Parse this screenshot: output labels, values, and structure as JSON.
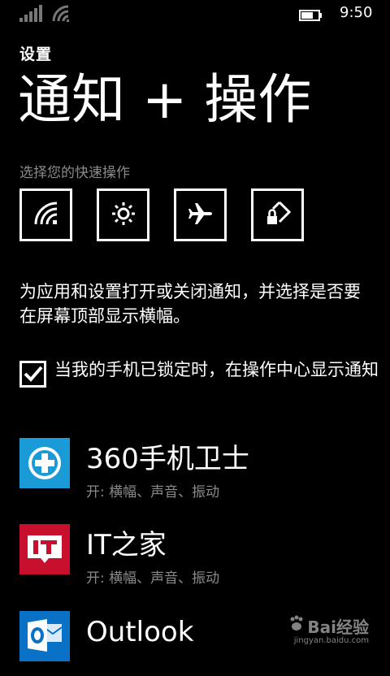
{
  "status_bar": {
    "time": "9:50",
    "signal_icon": "signal-bars-icon",
    "wifi_icon": "wifi-icon",
    "battery_icon": "battery-icon"
  },
  "header": {
    "app_label": "设置",
    "title": "通知 + 操作"
  },
  "quick_actions": {
    "heading": "选择您的快速操作",
    "items": [
      {
        "icon": "wifi-icon"
      },
      {
        "icon": "brightness-icon"
      },
      {
        "icon": "airplane-icon"
      },
      {
        "icon": "rotation-lock-icon"
      }
    ]
  },
  "description": "为应用和设置打开或关闭通知，并选择是否要在屏幕顶部显示横幅。",
  "lock_screen_option": {
    "label": "当我的手机已锁定时，在操作中心显示通知",
    "checked": true
  },
  "apps": [
    {
      "name": "360手机卫士",
      "status": "开: 横幅、声音、振动",
      "tile_color": "#1b9ad8",
      "icon": "plus-shield-icon"
    },
    {
      "name": "IT之家",
      "status": "开: 横幅、声音、振动",
      "tile_color": "#c8102e",
      "icon": "it-logo-icon"
    },
    {
      "name": "Outlook",
      "status": "",
      "tile_color": "#0a72c6",
      "icon": "outlook-icon"
    }
  ],
  "watermark": {
    "logo_text": "Bai经验",
    "url": "jingyan.baidu.com"
  }
}
